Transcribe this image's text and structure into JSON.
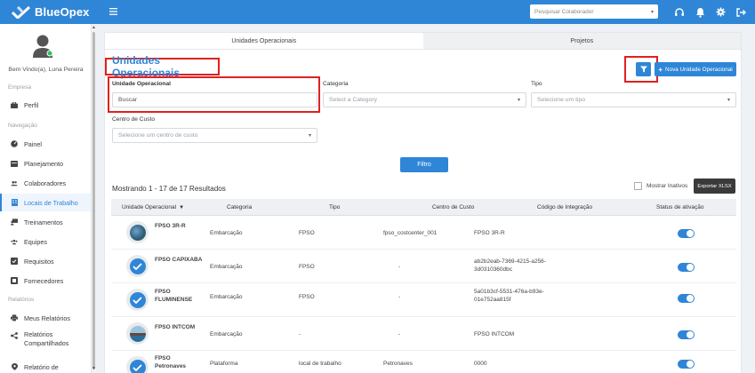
{
  "app": {
    "brand": "BlueOpex",
    "search_placeholder": "Pesquisar Colaborador"
  },
  "sidebar": {
    "welcome": "Bem Vindo(a), Luna Pereira",
    "sections": {
      "empresa": "Empresa",
      "navegacao": "Navegação",
      "relatorios": "Relatórios"
    },
    "items": {
      "perfil": "Perfil",
      "painel": "Painel",
      "planejamento": "Planejamento",
      "colaboradores": "Colaboradores",
      "locais": "Locais de Trabalho",
      "treinamentos": "Treinamentos",
      "equipes": "Equipes",
      "requisitos": "Requisitos",
      "fornecedores": "Fornecedores",
      "meus_relatorios": "Meus Relatórios",
      "relatorios_comp_1": "Relatórios",
      "relatorios_comp_2": "Compartilhados",
      "relatorio_de": "Relatório de"
    }
  },
  "tabs": {
    "unidades": "Unidades Operacionais",
    "projetos": "Projetos"
  },
  "page": {
    "title": "Unidades Operacionais",
    "new_button": "Nova Unidade Operacional",
    "filters": {
      "unidade_label": "Unidade Operacional",
      "unidade_placeholder": "Buscar",
      "categoria_label": "Categoria",
      "categoria_placeholder": "Select a Category",
      "tipo_label": "Tipo",
      "tipo_placeholder": "Selecione um tipo",
      "centro_label": "Centro de Custo",
      "centro_placeholder": "Selecione um centro de custo",
      "filter_button": "Filtro"
    },
    "results_text": "Mostrando 1 - 17 de 17 Resultados",
    "show_inactive": "Mostrar Inativos",
    "export_button": "Exportar XLSX"
  },
  "table": {
    "headers": {
      "unidade": "Unidade Operacional",
      "categoria": "Categoria",
      "tipo": "Tipo",
      "centro": "Centro de Custo",
      "codigo": "Código de Integração",
      "status": "Status de ativação"
    },
    "rows": [
      {
        "name_1": "FPSO 3R-R",
        "name_2": "",
        "categoria": "Embarcação",
        "tipo": "FPSO",
        "centro": "fpso_costcenter_001",
        "codigo_1": "FPSO 3R-R",
        "codigo_2": "",
        "active": true
      },
      {
        "name_1": "FPSO CAPIXABA",
        "name_2": "",
        "categoria": "Embarcação",
        "tipo": "FPSO",
        "centro": "-",
        "codigo_1": "ab2b2eab-7369-4215-a256-",
        "codigo_2": "3d0310360dbc",
        "active": true
      },
      {
        "name_1": "FPSO",
        "name_2": "FLUMINENSE",
        "categoria": "Embarcação",
        "tipo": "FPSO",
        "centro": "-",
        "codigo_1": "5a01b3cf-5531-476a-b93e-",
        "codigo_2": "01e752aa815f",
        "active": true
      },
      {
        "name_1": "FPSO INTCOM",
        "name_2": "",
        "categoria": "Embarcação",
        "tipo": "-",
        "centro": "-",
        "codigo_1": "FPSO INTCOM",
        "codigo_2": "",
        "active": true
      },
      {
        "name_1": "FPSO",
        "name_2": "Petronaves",
        "categoria": "Plataforma",
        "tipo": "local de trabalho",
        "centro": "Petronaves",
        "codigo_1": "0000",
        "codigo_2": "",
        "active": true
      }
    ]
  },
  "colors": {
    "primary": "#2f86d6",
    "highlight": "#e02020",
    "dark_button": "#3a3a3a"
  }
}
